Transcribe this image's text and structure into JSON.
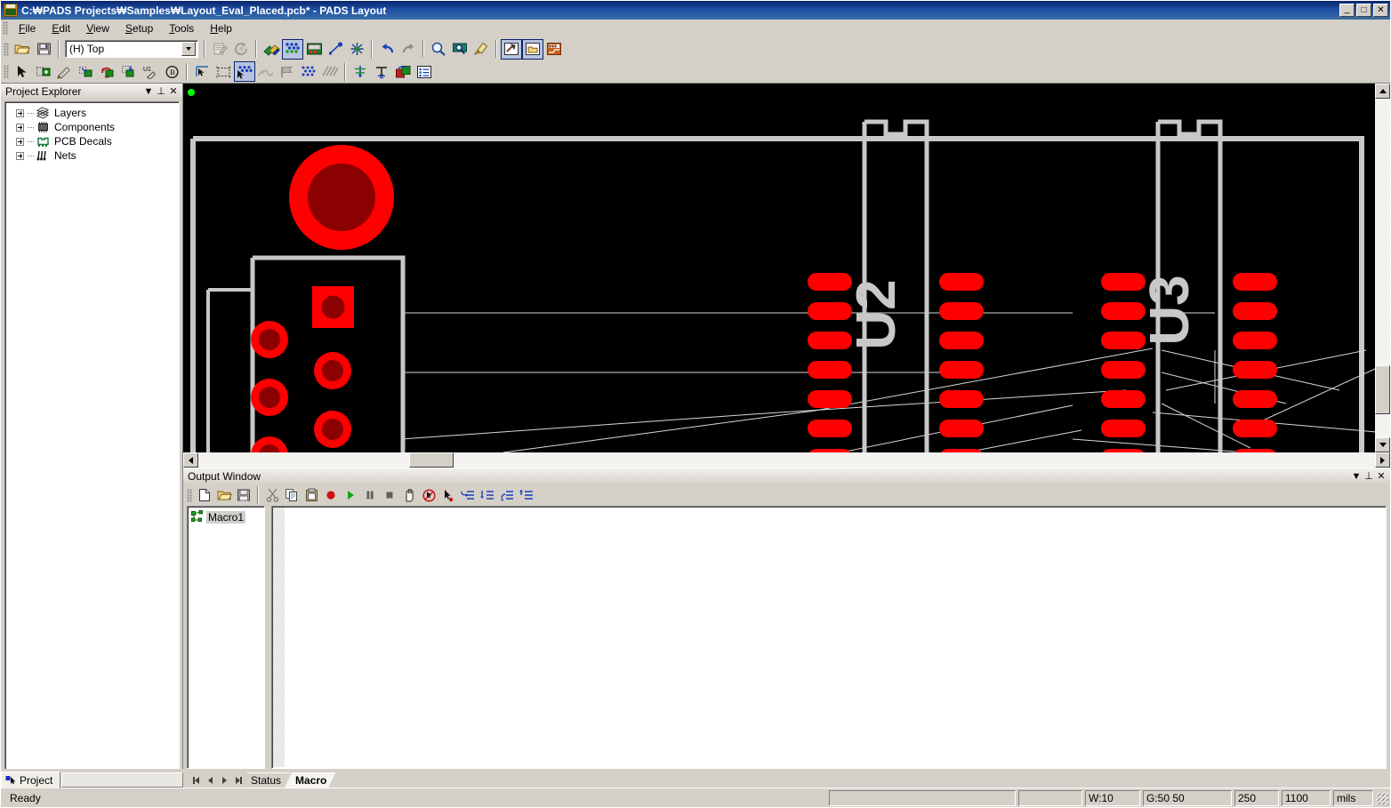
{
  "window": {
    "title": "C:₩PADS Projects₩Samples₩Layout_Eval_Placed.pcb* - PADS Layout",
    "app_icon": "pads-logo-icon",
    "buttons": {
      "minimize": "_",
      "maximize": "□",
      "close": "✕"
    }
  },
  "menu": {
    "items": [
      {
        "label": "File",
        "accel": "F"
      },
      {
        "label": "Edit",
        "accel": "E"
      },
      {
        "label": "View",
        "accel": "V"
      },
      {
        "label": "Setup",
        "accel": "S"
      },
      {
        "label": "Tools",
        "accel": "T"
      },
      {
        "label": "Help",
        "accel": "H"
      }
    ]
  },
  "toolbar_standard": {
    "layer_select": {
      "value": "(H) Top",
      "icon": "chevron-down-icon"
    },
    "items": [
      {
        "name": "open-file-button",
        "icon": "folder-open-icon",
        "state": "enabled"
      },
      {
        "name": "save-file-button",
        "icon": "floppy-disk-icon",
        "state": "enabled"
      },
      {
        "name": "design-rules-button",
        "icon": "document-gear-icon",
        "state": "disabled"
      },
      {
        "name": "refresh-button",
        "icon": "circular-arrows-icon",
        "state": "disabled"
      },
      {
        "name": "layer-display-button",
        "icon": "layers-color-icon",
        "state": "enabled"
      },
      {
        "name": "drafting-toolbar-button",
        "icon": "pads-blue-dots-icon",
        "state": "active"
      },
      {
        "name": "board-outline-button",
        "icon": "board-green-icon",
        "state": "enabled"
      },
      {
        "name": "route-button",
        "icon": "line-node-icon",
        "state": "enabled"
      },
      {
        "name": "split-plane-button",
        "icon": "starburst-icon",
        "state": "enabled"
      },
      {
        "name": "undo-button",
        "icon": "undo-arrow-icon",
        "state": "enabled"
      },
      {
        "name": "redo-button",
        "icon": "redo-arrow-icon",
        "state": "disabled"
      },
      {
        "name": "zoom-button",
        "icon": "magnifier-icon",
        "state": "enabled"
      },
      {
        "name": "zoom-area-button",
        "icon": "magnifier-screen-icon",
        "state": "enabled"
      },
      {
        "name": "redraw-button",
        "icon": "paintbrush-icon",
        "state": "enabled"
      },
      {
        "name": "pads-router-button",
        "icon": "hammer-window-icon",
        "state": "active"
      },
      {
        "name": "pads-library-button",
        "icon": "folder-window-icon",
        "state": "active"
      },
      {
        "name": "pads-logic-button",
        "icon": "pads-orange-icon",
        "state": "enabled"
      }
    ]
  },
  "toolbar_design": {
    "items": [
      {
        "name": "select-tool-button",
        "icon": "arrow-cursor-icon",
        "state": "enabled"
      },
      {
        "name": "add-component-button",
        "icon": "place-part-icon",
        "state": "enabled"
      },
      {
        "name": "dimension-button",
        "icon": "ruler-pencil-icon",
        "state": "enabled"
      },
      {
        "name": "move-button",
        "icon": "move-part-icon",
        "state": "enabled"
      },
      {
        "name": "rotate-button",
        "icon": "rotate-part-icon",
        "state": "enabled"
      },
      {
        "name": "flip-side-button",
        "icon": "flip-part-icon",
        "state": "enabled"
      },
      {
        "name": "rename-ref-des-button",
        "icon": "u1-label-icon",
        "state": "enabled"
      },
      {
        "name": "highlight-button",
        "icon": "circle-b-icon",
        "state": "enabled"
      },
      {
        "name": "select-anything-button",
        "icon": "corner-arrow-icon",
        "state": "enabled"
      },
      {
        "name": "select-shape-button",
        "icon": "dashed-box-icon",
        "state": "enabled"
      },
      {
        "name": "select-net-button",
        "icon": "arrow-dots-icon",
        "state": "active"
      },
      {
        "name": "add-route-button",
        "icon": "route-hill-icon",
        "state": "disabled"
      },
      {
        "name": "split-plane-tool-button",
        "icon": "flag-plane-icon",
        "state": "disabled"
      },
      {
        "name": "pour-manager-button",
        "icon": "dots-grid-icon",
        "state": "enabled"
      },
      {
        "name": "hatch-button",
        "icon": "hatch-lines-icon",
        "state": "disabled"
      },
      {
        "name": "net-ratsnest-button",
        "icon": "net-tree-icon",
        "state": "enabled"
      },
      {
        "name": "drill-button",
        "icon": "drill-down-icon",
        "state": "enabled"
      },
      {
        "name": "ecad-sync-button",
        "icon": "sync-parts-icon",
        "state": "enabled"
      },
      {
        "name": "reports-button",
        "icon": "list-report-icon",
        "state": "enabled"
      }
    ]
  },
  "project_explorer": {
    "title": "Project Explorer",
    "header_buttons": [
      {
        "name": "panel-menu-button",
        "glyph": "▼"
      },
      {
        "name": "panel-pin-button",
        "glyph": "⊥"
      },
      {
        "name": "panel-close-button",
        "glyph": "✕"
      }
    ],
    "tree": [
      {
        "label": "Layers",
        "icon": "layers-icon",
        "expander": "plus"
      },
      {
        "label": "Components",
        "icon": "component-icon",
        "expander": "plus"
      },
      {
        "label": "PCB Decals",
        "icon": "pcb-decal-icon",
        "expander": "plus"
      },
      {
        "label": "Nets",
        "icon": "nets-icon",
        "expander": "plus"
      }
    ]
  },
  "canvas": {
    "background_color": "#000000",
    "silkscreen_color": "#c0c0c0",
    "pad_color": "#ff0000",
    "hole_color": "#8b0000",
    "ratline_color": "#d8d8d8",
    "origin_marker_color": "#00ff00",
    "components": [
      {
        "ref": "U2",
        "type": "dip-ic"
      },
      {
        "ref": "U3",
        "type": "dip-ic"
      }
    ]
  },
  "output_window": {
    "title": "Output Window",
    "header_buttons": [
      {
        "name": "panel-menu-button",
        "glyph": "▼"
      },
      {
        "name": "panel-pin-button",
        "glyph": "⊥"
      },
      {
        "name": "panel-close-button",
        "glyph": "✕"
      }
    ],
    "toolbar": [
      {
        "name": "new-macro-button",
        "icon": "new-document-icon"
      },
      {
        "name": "open-macro-button",
        "icon": "folder-open-icon"
      },
      {
        "name": "save-macro-button",
        "icon": "floppy-disk-icon"
      },
      {
        "name": "cut-button",
        "icon": "scissors-icon"
      },
      {
        "name": "copy-button",
        "icon": "copy-icon"
      },
      {
        "name": "paste-button",
        "icon": "clipboard-icon"
      },
      {
        "name": "record-button",
        "icon": "record-red-dot-icon"
      },
      {
        "name": "run-button",
        "icon": "play-green-icon"
      },
      {
        "name": "pause-button",
        "icon": "pause-icon"
      },
      {
        "name": "stop-button",
        "icon": "stop-square-icon"
      },
      {
        "name": "step-hand-button",
        "icon": "hand-icon"
      },
      {
        "name": "disable-button",
        "icon": "no-entry-icon"
      },
      {
        "name": "pointer-record-button",
        "icon": "pointer-dot-icon"
      },
      {
        "name": "step-out-button",
        "icon": "step-out-icon"
      },
      {
        "name": "step-into-button",
        "icon": "step-into-icon"
      },
      {
        "name": "step-over-button",
        "icon": "step-over-icon"
      },
      {
        "name": "run-to-cursor-button",
        "icon": "run-to-cursor-icon"
      }
    ],
    "macro_list": [
      {
        "label": "Macro1",
        "icon": "macro-node-icon",
        "selected": true
      }
    ],
    "editor_text": ""
  },
  "bottom_tabs": {
    "project_tab": {
      "label": "Project",
      "icon": "project-icon",
      "active": true
    },
    "nav_buttons": [
      {
        "name": "first-sheet-button",
        "glyph": "|◀"
      },
      {
        "name": "prev-sheet-button",
        "glyph": "◀"
      },
      {
        "name": "next-sheet-button",
        "glyph": "▶"
      },
      {
        "name": "last-sheet-button",
        "glyph": "▶|"
      }
    ],
    "sheets": [
      {
        "label": "Status",
        "active": false
      },
      {
        "label": "Macro",
        "active": true
      }
    ]
  },
  "statusbar": {
    "message": "Ready",
    "cells": [
      {
        "name": "status-message-cell",
        "value": ""
      },
      {
        "name": "status-mode-cell",
        "value": ""
      },
      {
        "name": "width-cell",
        "value": "W:10"
      },
      {
        "name": "grid-cell",
        "value": "G:50 50"
      },
      {
        "name": "x-coordinate-cell",
        "value": "250"
      },
      {
        "name": "y-coordinate-cell",
        "value": "1100"
      },
      {
        "name": "units-cell",
        "value": "mils"
      }
    ]
  }
}
